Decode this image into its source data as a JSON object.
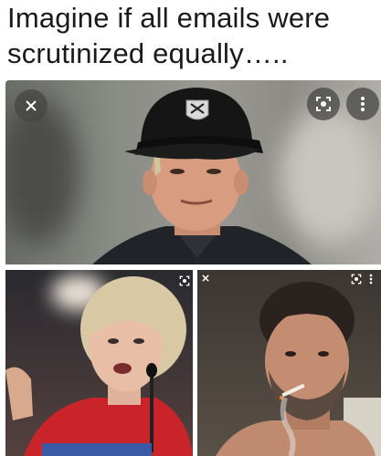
{
  "caption": {
    "line1": "Imagine if all emails were",
    "line2": "scrutinized equally….."
  },
  "photos": [
    {
      "subject": "man in black cap with raiders-style shield logo, dark jacket"
    },
    {
      "subject": "blonde woman in red top speaking at podium microphone"
    },
    {
      "subject": "man with beard smoking, dim room"
    }
  ],
  "icons": {
    "close": "close-icon",
    "lens": "lens-search-icon",
    "more": "more-vert-icon"
  },
  "colors": {
    "text": "#1a1a1a",
    "red_top": "#c8242a",
    "cap": "#151515"
  }
}
